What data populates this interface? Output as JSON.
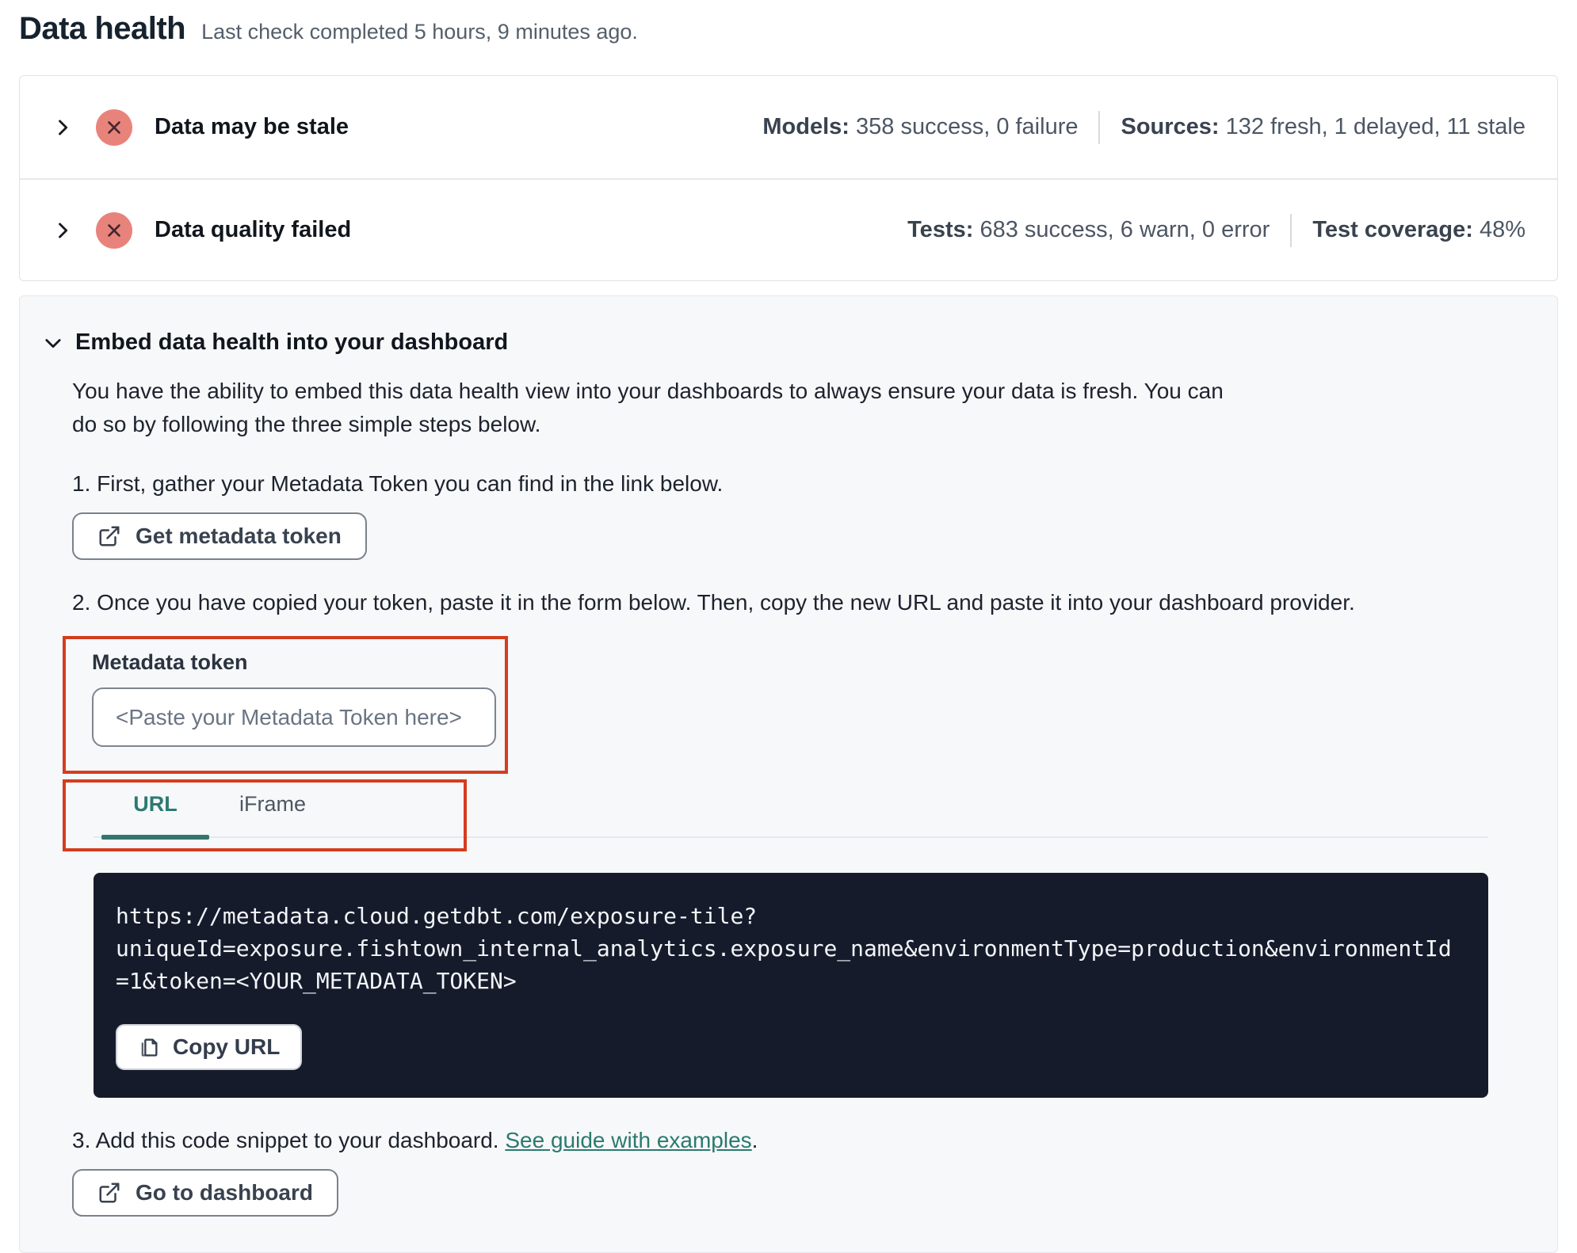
{
  "page": {
    "title": "Data health",
    "subtitle": "Last check completed 5 hours, 9 minutes ago."
  },
  "status_rows": [
    {
      "title": "Data may be stale",
      "status_icon": "x-circle",
      "stats": [
        {
          "label": "Models:",
          "value": "358 success, 0 failure"
        },
        {
          "label": "Sources:",
          "value": "132 fresh, 1 delayed, 11 stale"
        }
      ]
    },
    {
      "title": "Data quality failed",
      "status_icon": "x-circle",
      "stats": [
        {
          "label": "Tests:",
          "value": "683 success, 6 warn, 0 error"
        },
        {
          "label": "Test coverage:",
          "value": "48%"
        }
      ]
    }
  ],
  "embed": {
    "heading": "Embed data health into your dashboard",
    "description": "You have the ability to embed this data health view into your dashboards to always ensure your data is fresh. You can do so by following the three simple steps below.",
    "step1": "1. First, gather your Metadata Token you can find in the link below.",
    "get_token_button": "Get metadata token",
    "step2": "2. Once you have copied your token, paste it in the form below. Then, copy the new URL and paste it into your dashboard provider.",
    "token_form": {
      "label": "Metadata token",
      "placeholder": "<Paste your Metadata Token here>"
    },
    "tabs": [
      {
        "label": "URL",
        "active": true
      },
      {
        "label": "iFrame",
        "active": false
      }
    ],
    "code_lines": {
      "0": "https://metadata.cloud.getdbt.com/exposure-tile?",
      "1": "uniqueId=exposure.fishtown_internal_analytics.exposure_name&environmentType=production&environmentId",
      "2": "=1&token=<YOUR_METADATA_TOKEN>"
    },
    "copy_button": "Copy URL",
    "step3_prefix": "3. Add this code snippet to your dashboard. ",
    "step3_link": "See guide with examples",
    "step3_suffix": ".",
    "dashboard_button": "Go to dashboard"
  },
  "colors": {
    "annotation_red": "#d43d1e",
    "status_badge_bg": "#e8837c",
    "accent_teal": "#2c7a71",
    "code_block_bg": "#151b2b"
  }
}
